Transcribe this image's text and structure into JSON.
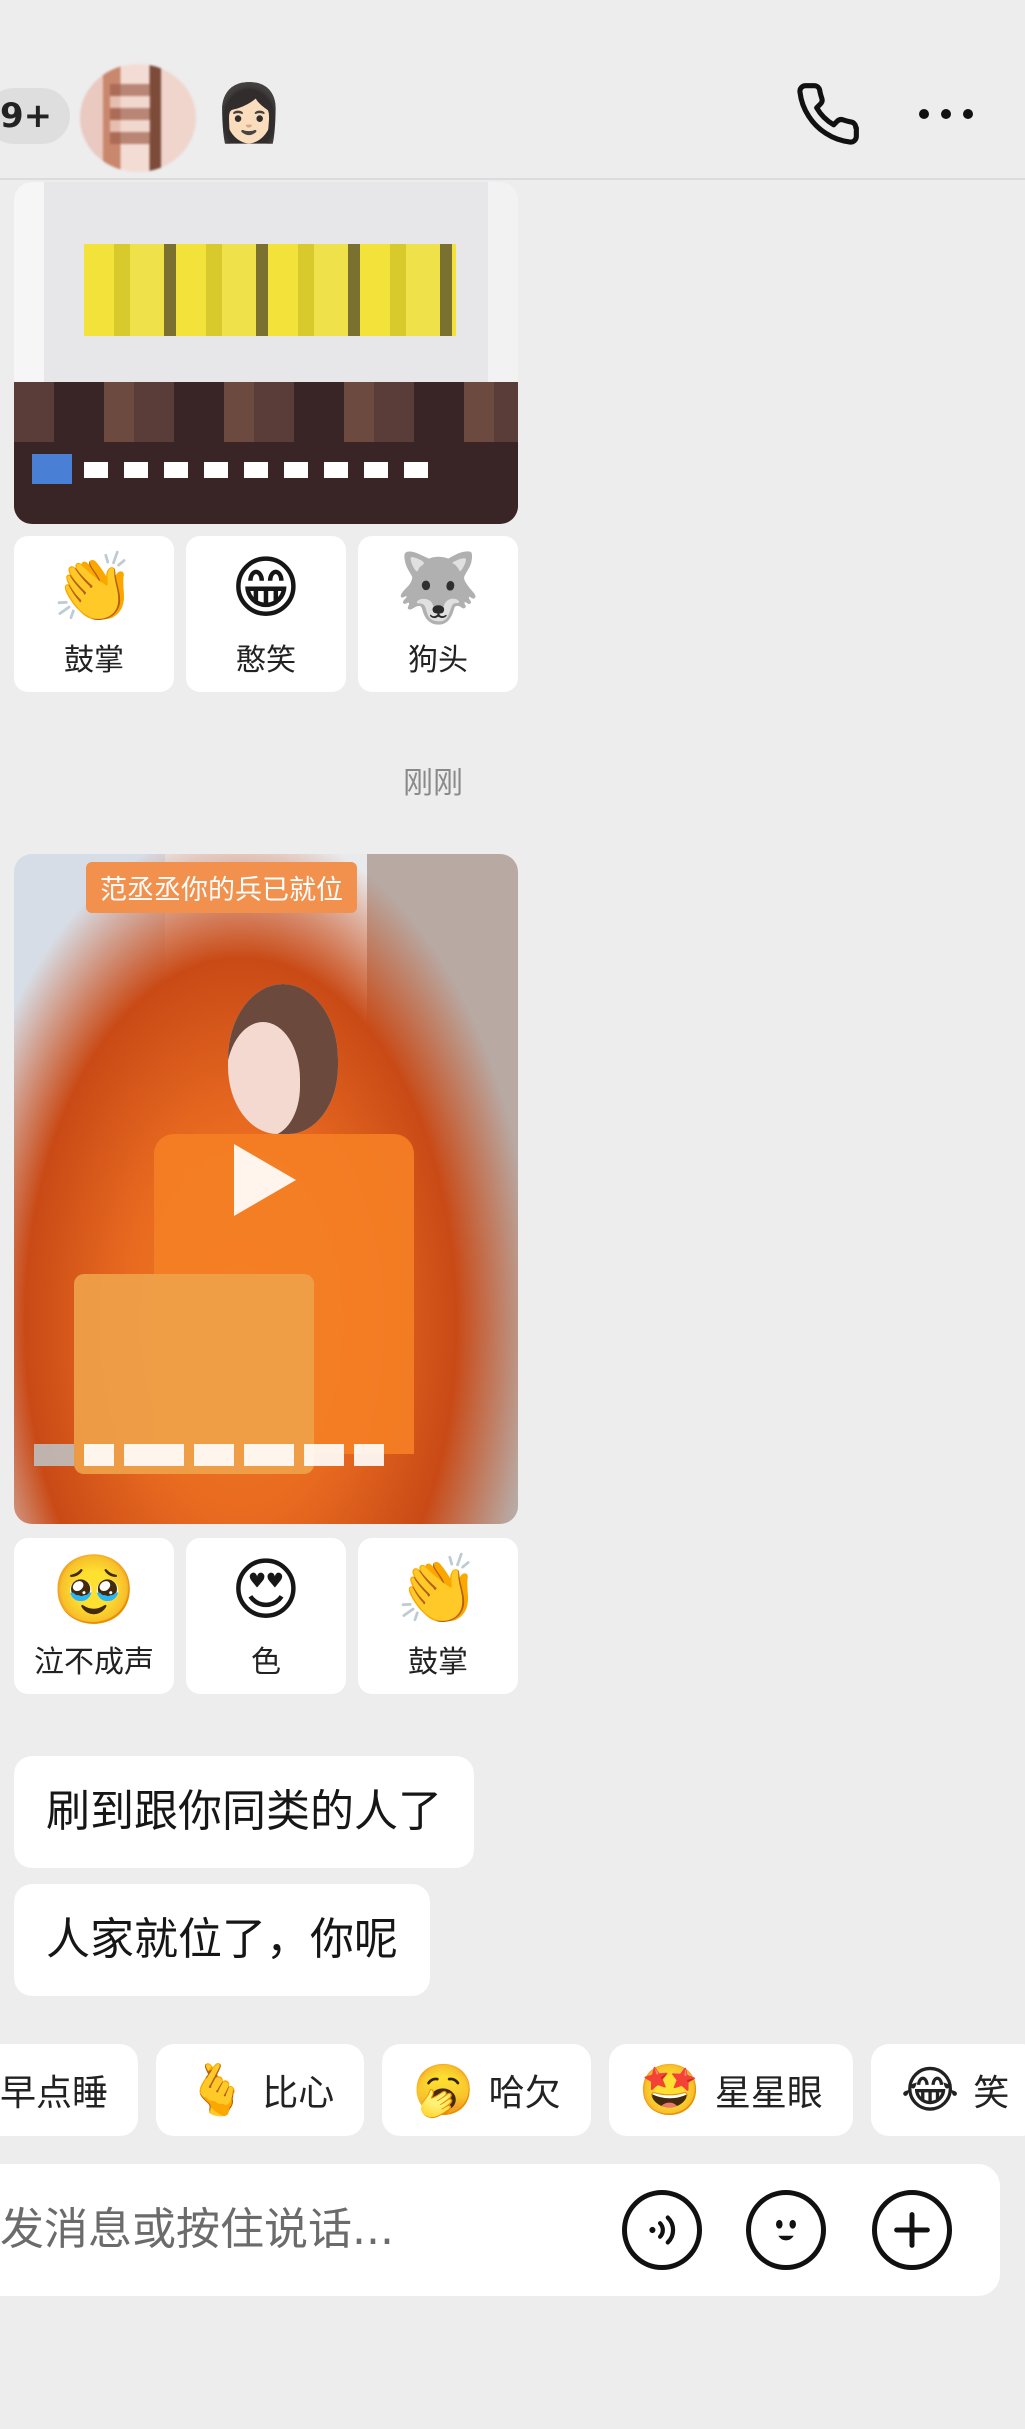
{
  "header": {
    "unread_badge": "9+",
    "face_emoji": "👩🏻",
    "icons": {
      "call": "phone-icon",
      "more": "more-dots-icon"
    }
  },
  "messages": {
    "first_card": {
      "reactions": [
        {
          "emoji": "👏",
          "label": "鼓掌"
        },
        {
          "emoji": "😁",
          "label": "憨笑"
        },
        {
          "emoji": "🐺",
          "label": "狗头"
        }
      ]
    },
    "timestamp": "刚刚",
    "video_card": {
      "banner": "范丞丞你的兵已就位",
      "reactions": [
        {
          "emoji": "🥹",
          "label": "泣不成声"
        },
        {
          "emoji": "😍",
          "label": "色"
        },
        {
          "emoji": "👏",
          "label": "鼓掌"
        }
      ]
    },
    "bubbles": [
      "刷到跟你同类的人了",
      "人家就位了，你呢"
    ]
  },
  "quick_replies": [
    {
      "emoji": "",
      "label": "早点睡"
    },
    {
      "emoji": "🫰",
      "label": "比心"
    },
    {
      "emoji": "🥱",
      "label": "哈欠"
    },
    {
      "emoji": "🤩",
      "label": "星星眼"
    },
    {
      "emoji": "😂",
      "label": "笑"
    }
  ],
  "input": {
    "placeholder": "发消息或按住说话...",
    "icons": [
      "voice-icon",
      "emoji-face-icon",
      "plus-icon"
    ]
  },
  "colors": {
    "background": "#ededed",
    "card": "#ffffff",
    "video_banner": "#f2904e"
  }
}
